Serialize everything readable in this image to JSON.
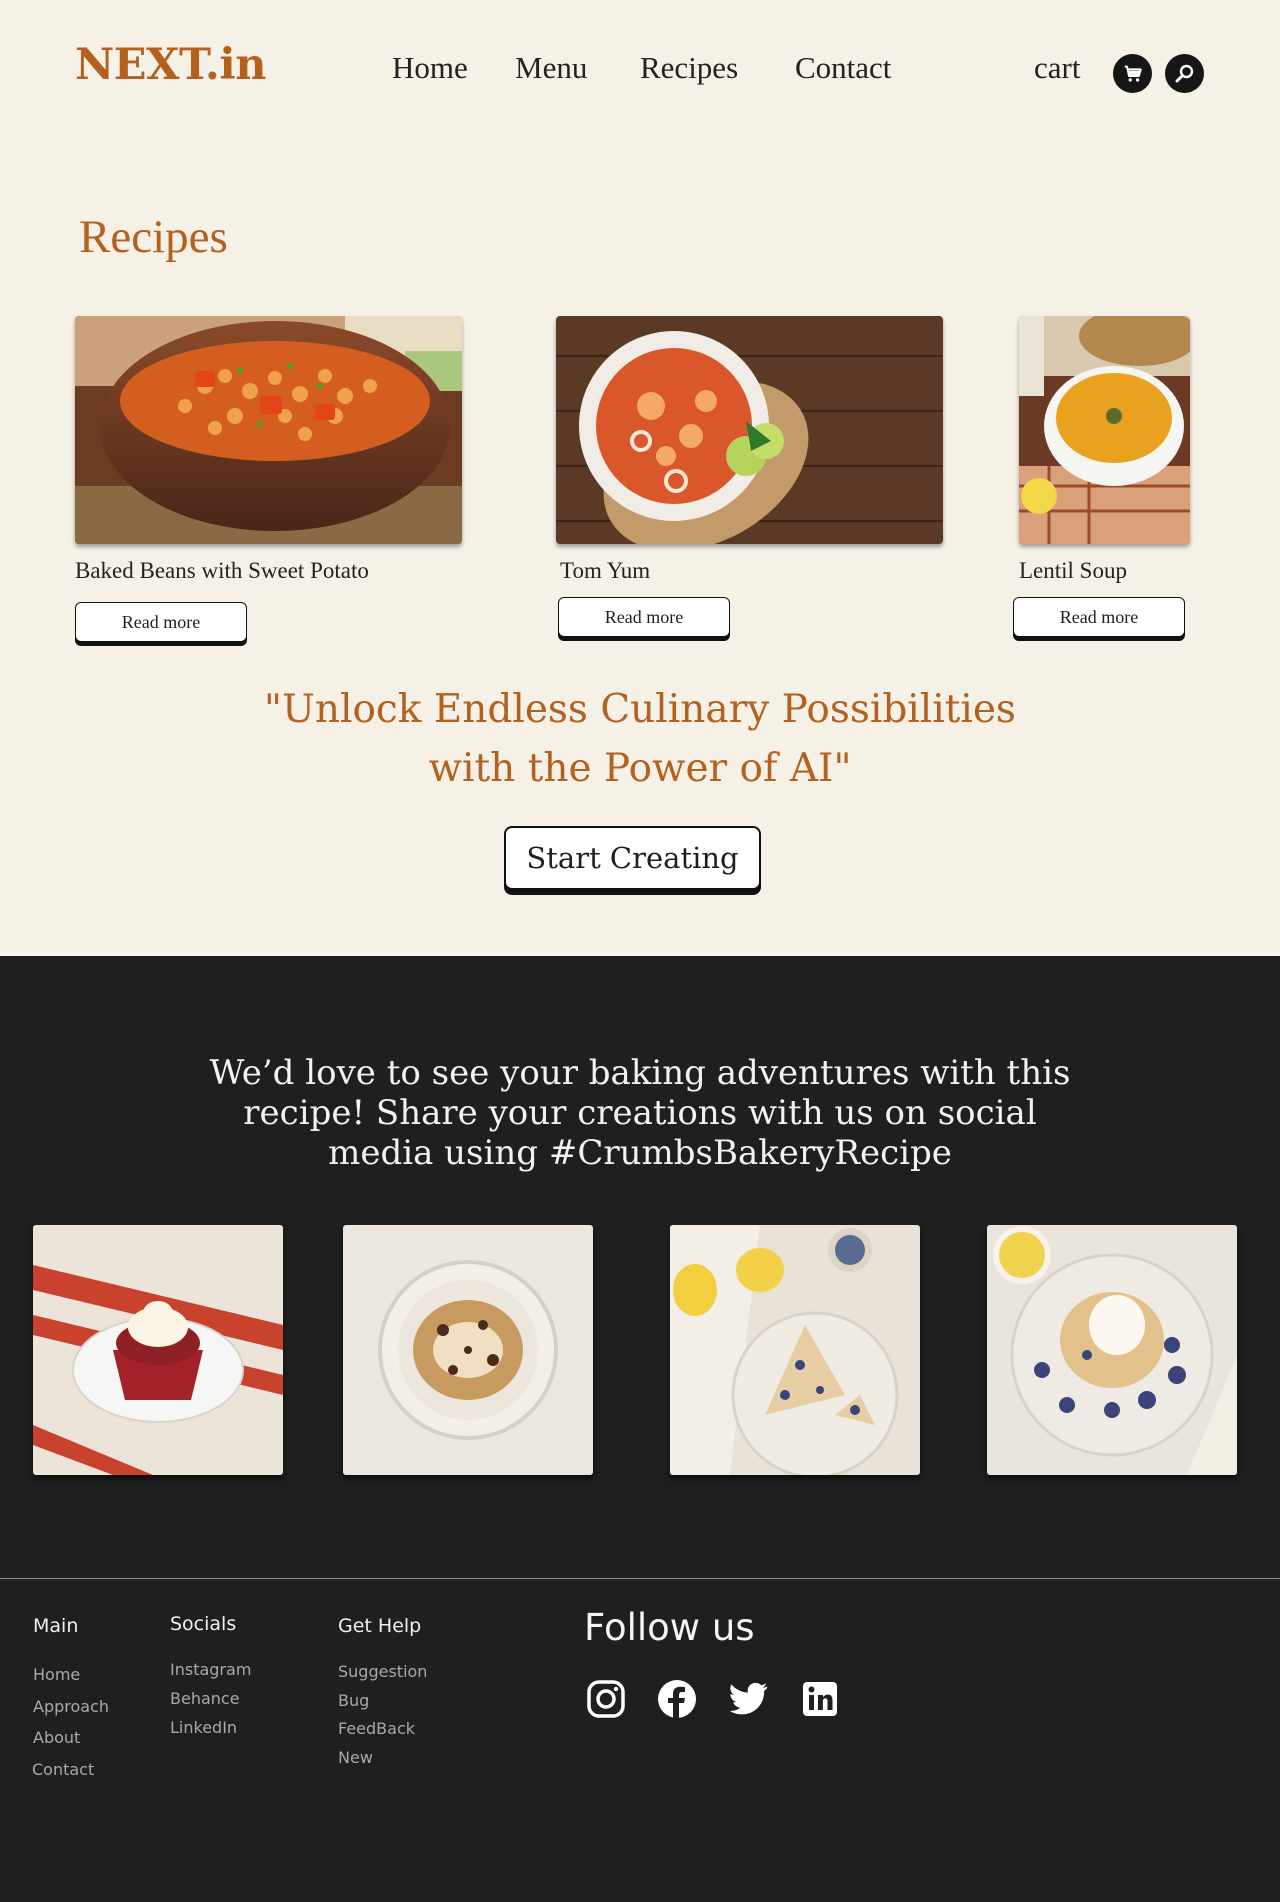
{
  "header": {
    "logo": "NEXT.in",
    "nav": [
      "Home",
      "Menu",
      "Recipes",
      "Contact"
    ],
    "cart_label": "cart",
    "cart_icon": "cart-icon",
    "search_icon": "search-icon"
  },
  "recipes": {
    "title": "Recipes",
    "items": [
      {
        "name": "Baked Beans with Sweet Potato",
        "button": "Read more"
      },
      {
        "name": "Tom Yum",
        "button": "Read more"
      },
      {
        "name": "Lentil Soup",
        "button": "Read more"
      }
    ]
  },
  "cta": {
    "quote_line1": "\"Unlock Endless Culinary Possibilities",
    "quote_line2": "with the Power of AI\"",
    "button": "Start Creating"
  },
  "share": {
    "line1": "We’d love to see your baking adventures with this",
    "line2": "recipe! Share your creations with us on social",
    "line3": "media using #CrumbsBakeryRecipe",
    "photos": [
      "red-velvet-cupcake",
      "chocolate-chip-cookie",
      "blueberry-scone",
      "blueberry-scone-with-cream"
    ]
  },
  "footer": {
    "main": {
      "title": "Main",
      "links": [
        "Home",
        "Approach",
        "About",
        "Contact"
      ]
    },
    "socials": {
      "title": "Socials",
      "links": [
        "Instagram",
        "Behance",
        "LinkedIn"
      ]
    },
    "help": {
      "title": "Get Help",
      "links": [
        "Suggestion",
        "Bug",
        "FeedBack",
        "New"
      ]
    },
    "follow": "Follow us",
    "icons": [
      "instagram-icon",
      "facebook-icon",
      "twitter-icon",
      "linkedin-icon"
    ]
  },
  "colors": {
    "accent": "#b4601f",
    "background": "#f6f1e6",
    "dark": "#1f1f1f"
  }
}
